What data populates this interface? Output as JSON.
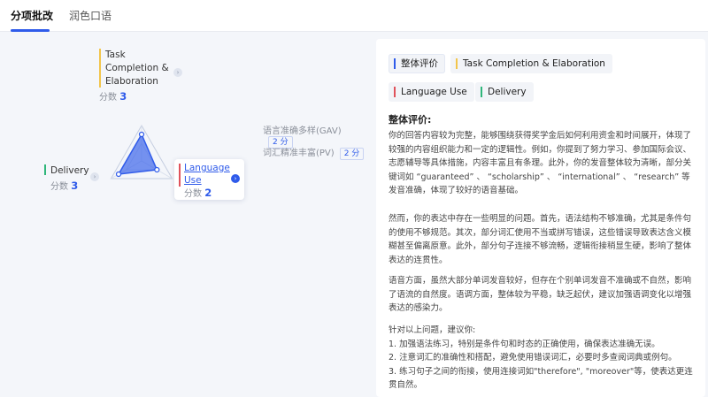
{
  "tabs": [
    {
      "label": "分项批改",
      "active": true
    },
    {
      "label": "润色口语",
      "active": false
    }
  ],
  "radar": {
    "task": {
      "label": "Task Completion & Elaboration",
      "lines": [
        "Task",
        "Completion &",
        "Elaboration"
      ],
      "score_prefix": "分数",
      "score": "3",
      "color": "#f2c54b"
    },
    "delivery": {
      "label": "Delivery",
      "score_prefix": "分数",
      "score": "3",
      "color": "#2fb67a"
    },
    "language": {
      "lines": [
        "Language",
        "Use"
      ],
      "score_prefix": "分数",
      "score": "2",
      "color": "#e0525b"
    },
    "sub_scores": [
      {
        "label": "语言准确多样(GAV)",
        "value": "2 分"
      },
      {
        "label": "词汇精准丰富(PV)",
        "value": "2 分"
      }
    ],
    "values": [
      3,
      2,
      3
    ],
    "max": 4,
    "accent": "#2f5bea"
  },
  "panel": {
    "chips": [
      {
        "label": "整体评价",
        "color": "#2f5bea"
      },
      {
        "label": "Task Completion & Elaboration",
        "color": "#f2c54b"
      },
      {
        "label": "Language Use",
        "color": "#e0525b"
      },
      {
        "label": "Delivery",
        "color": "#2fb67a"
      }
    ],
    "title": "整体评价:",
    "paragraphs": [
      "你的回答内容较为完整，能够围绕获得奖学金后如何利用资金和时间展开，体现了较强的内容组织能力和一定的逻辑性。例如，你提到了努力学习、参加国际会议、志愿辅导等具体措施，内容丰富且有条理。此外，你的发音整体较为清晰，部分关键词如 “guaranteed” 、 “scholarship” 、 “international” 、 “research” 等发音准确，体现了较好的语音基础。",
      "然而，你的表达中存在一些明显的问题。首先，语法结构不够准确，尤其是条件句的使用不够规范。其次，部分词汇使用不当或拼写错误，这些错误导致表达含义模糊甚至偏离原意。此外，部分句子连接不够流畅，逻辑衔接稍显生硬，影响了整体表达的连贯性。",
      "语音方面，虽然大部分单词发音较好，但存在个别单词发音不准确或不自然，影响了语流的自然度。语调方面，整体较为平稳，缺乏起伏，建议加强语调变化以增强表达的感染力。",
      "针对以上问题，建议你:\n1. 加强语法练习，特别是条件句和时态的正确使用，确保表达准确无误。\n2. 注意词汇的准确性和搭配，避免使用错误词汇，必要时多查阅词典或例句。\n3. 练习句子之间的衔接，使用连接词如\"therefore\", \"moreover\"等，使表达更连贯自然。"
    ]
  }
}
